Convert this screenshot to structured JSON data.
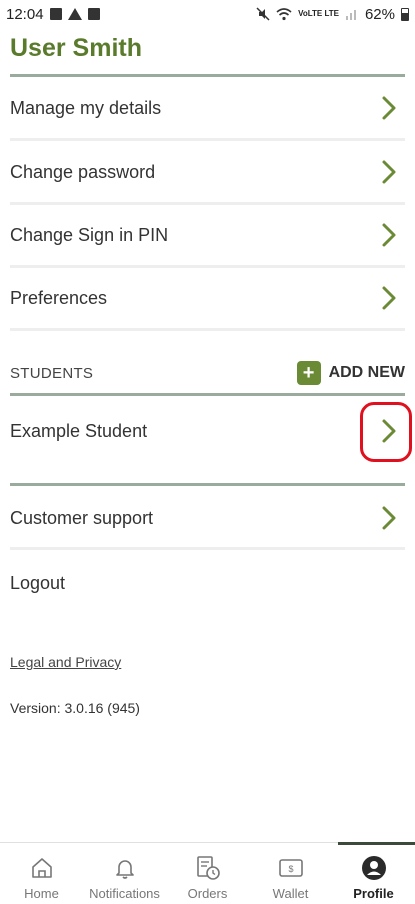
{
  "status_bar": {
    "time": "12:04",
    "battery": "62%",
    "network": "VoLTE LTE"
  },
  "header": {
    "title": "User Smith"
  },
  "account_menu": [
    {
      "label": "Manage my details"
    },
    {
      "label": "Change password"
    },
    {
      "label": "Change Sign in PIN"
    },
    {
      "label": "Preferences"
    }
  ],
  "students": {
    "section_label": "STUDENTS",
    "add_new_label": "ADD NEW",
    "items": [
      {
        "name": "Example Student"
      }
    ]
  },
  "support": {
    "label": "Customer support"
  },
  "logout": {
    "label": "Logout"
  },
  "footer": {
    "legal_label": "Legal and Privacy",
    "version": "Version: 3.0.16 (945)"
  },
  "tabbar": {
    "tabs": [
      {
        "label": "Home",
        "icon": "home-icon"
      },
      {
        "label": "Notifications",
        "icon": "bell-icon"
      },
      {
        "label": "Orders",
        "icon": "orders-icon"
      },
      {
        "label": "Wallet",
        "icon": "wallet-icon"
      },
      {
        "label": "Profile",
        "icon": "profile-icon",
        "active": true
      }
    ]
  },
  "colors": {
    "accent": "#5a7a2c",
    "chevron": "#6b8a35",
    "highlight": "#e0101e"
  }
}
